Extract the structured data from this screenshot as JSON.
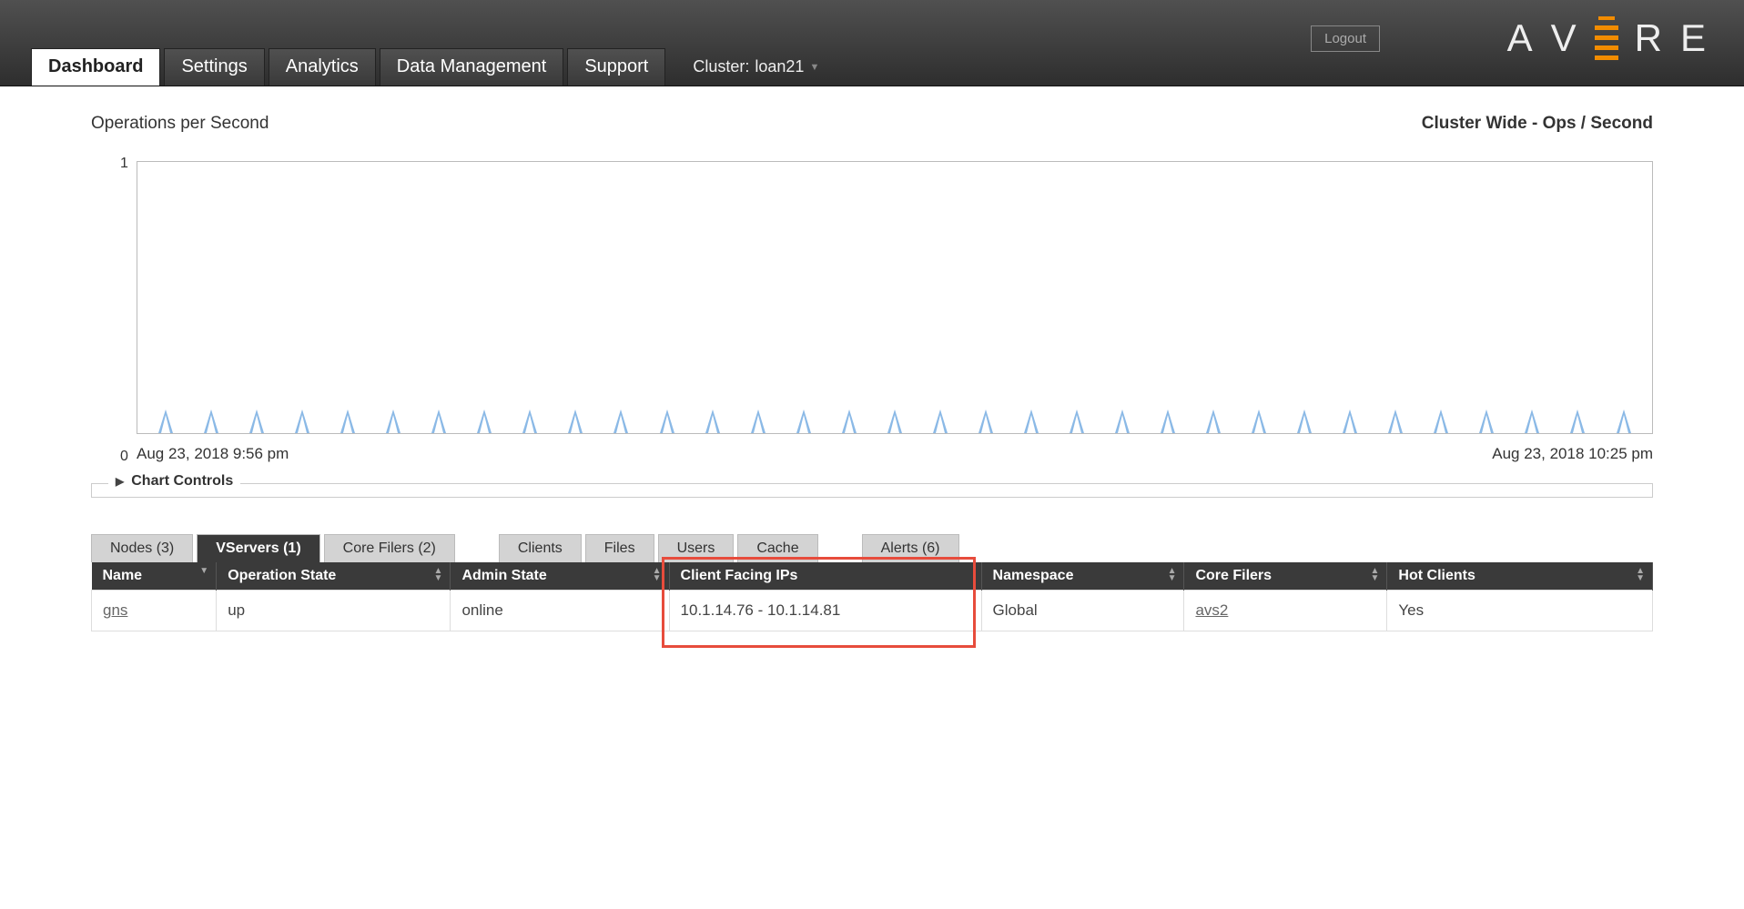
{
  "header": {
    "logout": "Logout",
    "cluster_prefix": "Cluster:",
    "cluster_name": "loan21",
    "logo_letters": [
      "A",
      "V",
      "E",
      "R",
      "E"
    ]
  },
  "nav": {
    "tabs": [
      "Dashboard",
      "Settings",
      "Analytics",
      "Data Management",
      "Support"
    ],
    "active": 0
  },
  "chart": {
    "title_left": "Operations per Second",
    "title_right": "Cluster Wide - Ops / Second",
    "y_max_label": "1",
    "y_min_label": "0",
    "x_min_label": "Aug 23, 2018 9:56 pm",
    "x_max_label": "Aug 23, 2018 10:25 pm",
    "controls_label": "Chart Controls",
    "spike_count": 33
  },
  "chart_data": {
    "type": "line",
    "title": "Operations per Second — Cluster Wide - Ops / Second",
    "xlabel": "",
    "ylabel": "",
    "ylim": [
      0,
      1
    ],
    "x_range": [
      "Aug 23, 2018 9:56 pm",
      "Aug 23, 2018 10:25 pm"
    ],
    "note": "Approx. 33 evenly spaced short spikes between 0 and ~0.1 on the y-axis",
    "series": [
      {
        "name": "Ops/Second",
        "approx_peak": 0.1,
        "baseline": 0,
        "spike_count": 33
      }
    ]
  },
  "sub_tabs": {
    "group1": [
      "Nodes (3)",
      "VServers (1)",
      "Core Filers (2)"
    ],
    "group2": [
      "Clients",
      "Files",
      "Users",
      "Cache"
    ],
    "group3": [
      "Alerts (6)"
    ],
    "active_group": 0,
    "active_index": 1
  },
  "table": {
    "columns": [
      "Name",
      "Operation State",
      "Admin State",
      "Client Facing IPs",
      "Namespace",
      "Core Filers",
      "Hot Clients"
    ],
    "highlight_column_index": 3,
    "rows": [
      {
        "name": "gns",
        "operation_state": "up",
        "admin_state": "online",
        "client_ips": "10.1.14.76 - 10.1.14.81",
        "namespace": "Global",
        "core_filers": "avs2",
        "hot_clients": "Yes"
      }
    ]
  }
}
